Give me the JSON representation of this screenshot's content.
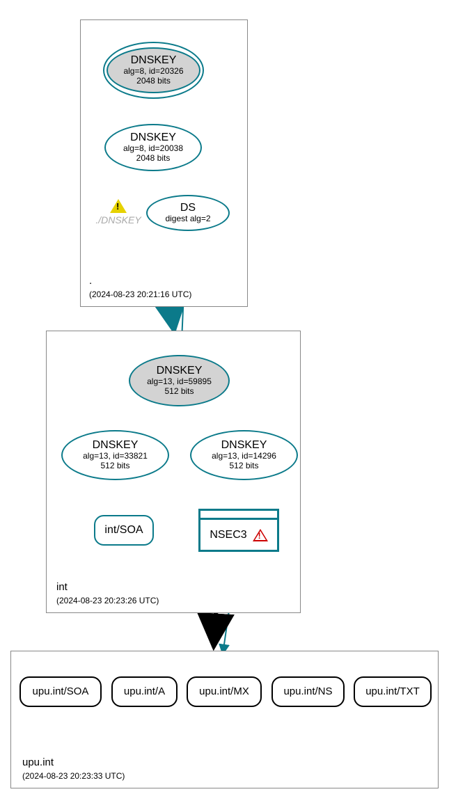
{
  "chart_data": {
    "type": "graph",
    "zones": [
      {
        "name": ".",
        "timestamp": "(2024-08-23 20:21:16 UTC)",
        "nodes": [
          {
            "id": "root-ksk",
            "type": "DNSKEY-KSK",
            "label": "DNSKEY",
            "line2": "alg=8, id=20326",
            "line3": "2048 bits",
            "self_loop": true
          },
          {
            "id": "root-zsk",
            "type": "DNSKEY",
            "label": "DNSKEY",
            "line2": "alg=8, id=20038",
            "line3": "2048 bits"
          },
          {
            "id": "root-warn",
            "type": "warning",
            "label": "./DNSKEY"
          },
          {
            "id": "root-ds",
            "type": "DS",
            "label": "DS",
            "line2": "digest alg=2"
          }
        ],
        "edges": [
          [
            "root-ksk",
            "root-ksk"
          ],
          [
            "root-ksk",
            "root-zsk"
          ],
          [
            "root-zsk",
            "root-ds"
          ]
        ]
      },
      {
        "name": "int",
        "timestamp": "(2024-08-23 20:23:26 UTC)",
        "nodes": [
          {
            "id": "int-ksk",
            "type": "DNSKEY-KSK",
            "label": "DNSKEY",
            "line2": "alg=13, id=59895",
            "line3": "512 bits",
            "self_loop": true
          },
          {
            "id": "int-zsk1",
            "type": "DNSKEY",
            "label": "DNSKEY",
            "line2": "alg=13, id=33821",
            "line3": "512 bits"
          },
          {
            "id": "int-zsk2",
            "type": "DNSKEY",
            "label": "DNSKEY",
            "line2": "alg=13, id=14296",
            "line3": "512 bits"
          },
          {
            "id": "int-soa",
            "type": "RR",
            "label": "int/SOA"
          },
          {
            "id": "int-nsec3",
            "type": "NSEC3",
            "label": "NSEC3",
            "error": true
          }
        ],
        "edges": [
          [
            "int-ksk",
            "int-ksk"
          ],
          [
            "int-ksk",
            "int-zsk1"
          ],
          [
            "int-ksk",
            "int-zsk2"
          ],
          [
            "int-zsk1",
            "int-soa"
          ],
          [
            "int-zsk2",
            "int-nsec3"
          ]
        ]
      },
      {
        "name": "upu.int",
        "timestamp": "(2024-08-23 20:23:33 UTC)",
        "nodes": [
          {
            "id": "upu-soa",
            "type": "RR",
            "label": "upu.int/SOA"
          },
          {
            "id": "upu-a",
            "type": "RR",
            "label": "upu.int/A"
          },
          {
            "id": "upu-mx",
            "type": "RR",
            "label": "upu.int/MX"
          },
          {
            "id": "upu-ns",
            "type": "RR",
            "label": "upu.int/NS"
          },
          {
            "id": "upu-txt",
            "type": "RR",
            "label": "upu.int/TXT"
          }
        ]
      }
    ],
    "delegations": [
      [
        "root-ds",
        "int-ksk"
      ],
      [
        ".",
        "int"
      ],
      [
        "int-nsec3",
        "upu.int"
      ],
      [
        "int",
        "upu.int"
      ]
    ]
  },
  "zones": {
    "root": {
      "label": ".",
      "time": "(2024-08-23 20:21:16 UTC)"
    },
    "int": {
      "label": "int",
      "time": "(2024-08-23 20:23:26 UTC)"
    },
    "upu": {
      "label": "upu.int",
      "time": "(2024-08-23 20:23:33 UTC)"
    }
  },
  "nodes": {
    "root_ksk": {
      "title": "DNSKEY",
      "l2": "alg=8, id=20326",
      "l3": "2048 bits"
    },
    "root_zsk": {
      "title": "DNSKEY",
      "l2": "alg=8, id=20038",
      "l3": "2048 bits"
    },
    "root_warn": {
      "label": "./DNSKEY"
    },
    "root_ds": {
      "title": "DS",
      "l2": "digest alg=2"
    },
    "int_ksk": {
      "title": "DNSKEY",
      "l2": "alg=13, id=59895",
      "l3": "512 bits"
    },
    "int_zsk1": {
      "title": "DNSKEY",
      "l2": "alg=13, id=33821",
      "l3": "512 bits"
    },
    "int_zsk2": {
      "title": "DNSKEY",
      "l2": "alg=13, id=14296",
      "l3": "512 bits"
    },
    "int_soa": {
      "label": "int/SOA"
    },
    "int_nsec3": {
      "label": "NSEC3"
    },
    "upu_soa": {
      "label": "upu.int/SOA"
    },
    "upu_a": {
      "label": "upu.int/A"
    },
    "upu_mx": {
      "label": "upu.int/MX"
    },
    "upu_ns": {
      "label": "upu.int/NS"
    },
    "upu_txt": {
      "label": "upu.int/TXT"
    }
  }
}
